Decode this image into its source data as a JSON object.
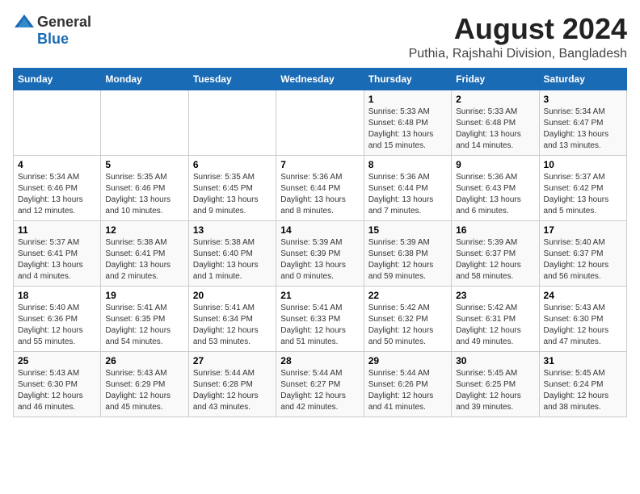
{
  "header": {
    "logo_general": "General",
    "logo_blue": "Blue",
    "title": "August 2024",
    "subtitle": "Puthia, Rajshahi Division, Bangladesh"
  },
  "calendar": {
    "days_of_week": [
      "Sunday",
      "Monday",
      "Tuesday",
      "Wednesday",
      "Thursday",
      "Friday",
      "Saturday"
    ],
    "weeks": [
      [
        {
          "day": "",
          "info": ""
        },
        {
          "day": "",
          "info": ""
        },
        {
          "day": "",
          "info": ""
        },
        {
          "day": "",
          "info": ""
        },
        {
          "day": "1",
          "info": "Sunrise: 5:33 AM\nSunset: 6:48 PM\nDaylight: 13 hours\nand 15 minutes."
        },
        {
          "day": "2",
          "info": "Sunrise: 5:33 AM\nSunset: 6:48 PM\nDaylight: 13 hours\nand 14 minutes."
        },
        {
          "day": "3",
          "info": "Sunrise: 5:34 AM\nSunset: 6:47 PM\nDaylight: 13 hours\nand 13 minutes."
        }
      ],
      [
        {
          "day": "4",
          "info": "Sunrise: 5:34 AM\nSunset: 6:46 PM\nDaylight: 13 hours\nand 12 minutes."
        },
        {
          "day": "5",
          "info": "Sunrise: 5:35 AM\nSunset: 6:46 PM\nDaylight: 13 hours\nand 10 minutes."
        },
        {
          "day": "6",
          "info": "Sunrise: 5:35 AM\nSunset: 6:45 PM\nDaylight: 13 hours\nand 9 minutes."
        },
        {
          "day": "7",
          "info": "Sunrise: 5:36 AM\nSunset: 6:44 PM\nDaylight: 13 hours\nand 8 minutes."
        },
        {
          "day": "8",
          "info": "Sunrise: 5:36 AM\nSunset: 6:44 PM\nDaylight: 13 hours\nand 7 minutes."
        },
        {
          "day": "9",
          "info": "Sunrise: 5:36 AM\nSunset: 6:43 PM\nDaylight: 13 hours\nand 6 minutes."
        },
        {
          "day": "10",
          "info": "Sunrise: 5:37 AM\nSunset: 6:42 PM\nDaylight: 13 hours\nand 5 minutes."
        }
      ],
      [
        {
          "day": "11",
          "info": "Sunrise: 5:37 AM\nSunset: 6:41 PM\nDaylight: 13 hours\nand 4 minutes."
        },
        {
          "day": "12",
          "info": "Sunrise: 5:38 AM\nSunset: 6:41 PM\nDaylight: 13 hours\nand 2 minutes."
        },
        {
          "day": "13",
          "info": "Sunrise: 5:38 AM\nSunset: 6:40 PM\nDaylight: 13 hours\nand 1 minute."
        },
        {
          "day": "14",
          "info": "Sunrise: 5:39 AM\nSunset: 6:39 PM\nDaylight: 13 hours\nand 0 minutes."
        },
        {
          "day": "15",
          "info": "Sunrise: 5:39 AM\nSunset: 6:38 PM\nDaylight: 12 hours\nand 59 minutes."
        },
        {
          "day": "16",
          "info": "Sunrise: 5:39 AM\nSunset: 6:37 PM\nDaylight: 12 hours\nand 58 minutes."
        },
        {
          "day": "17",
          "info": "Sunrise: 5:40 AM\nSunset: 6:37 PM\nDaylight: 12 hours\nand 56 minutes."
        }
      ],
      [
        {
          "day": "18",
          "info": "Sunrise: 5:40 AM\nSunset: 6:36 PM\nDaylight: 12 hours\nand 55 minutes."
        },
        {
          "day": "19",
          "info": "Sunrise: 5:41 AM\nSunset: 6:35 PM\nDaylight: 12 hours\nand 54 minutes."
        },
        {
          "day": "20",
          "info": "Sunrise: 5:41 AM\nSunset: 6:34 PM\nDaylight: 12 hours\nand 53 minutes."
        },
        {
          "day": "21",
          "info": "Sunrise: 5:41 AM\nSunset: 6:33 PM\nDaylight: 12 hours\nand 51 minutes."
        },
        {
          "day": "22",
          "info": "Sunrise: 5:42 AM\nSunset: 6:32 PM\nDaylight: 12 hours\nand 50 minutes."
        },
        {
          "day": "23",
          "info": "Sunrise: 5:42 AM\nSunset: 6:31 PM\nDaylight: 12 hours\nand 49 minutes."
        },
        {
          "day": "24",
          "info": "Sunrise: 5:43 AM\nSunset: 6:30 PM\nDaylight: 12 hours\nand 47 minutes."
        }
      ],
      [
        {
          "day": "25",
          "info": "Sunrise: 5:43 AM\nSunset: 6:30 PM\nDaylight: 12 hours\nand 46 minutes."
        },
        {
          "day": "26",
          "info": "Sunrise: 5:43 AM\nSunset: 6:29 PM\nDaylight: 12 hours\nand 45 minutes."
        },
        {
          "day": "27",
          "info": "Sunrise: 5:44 AM\nSunset: 6:28 PM\nDaylight: 12 hours\nand 43 minutes."
        },
        {
          "day": "28",
          "info": "Sunrise: 5:44 AM\nSunset: 6:27 PM\nDaylight: 12 hours\nand 42 minutes."
        },
        {
          "day": "29",
          "info": "Sunrise: 5:44 AM\nSunset: 6:26 PM\nDaylight: 12 hours\nand 41 minutes."
        },
        {
          "day": "30",
          "info": "Sunrise: 5:45 AM\nSunset: 6:25 PM\nDaylight: 12 hours\nand 39 minutes."
        },
        {
          "day": "31",
          "info": "Sunrise: 5:45 AM\nSunset: 6:24 PM\nDaylight: 12 hours\nand 38 minutes."
        }
      ]
    ]
  }
}
